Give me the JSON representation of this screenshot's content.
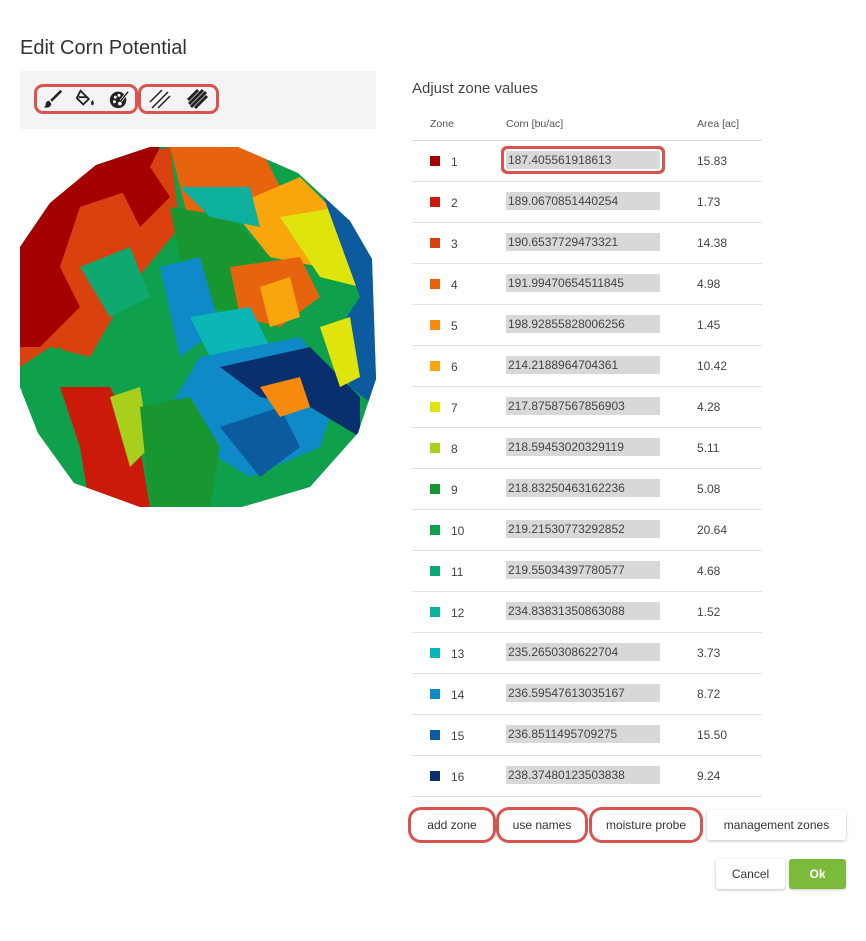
{
  "dialog": {
    "title": "Edit Corn Potential"
  },
  "toolbar": {
    "tools": [
      {
        "name": "brush-icon"
      },
      {
        "name": "paint-bucket-icon"
      },
      {
        "name": "palette-icon"
      },
      {
        "name": "hatch-light-icon"
      },
      {
        "name": "hatch-dense-icon"
      }
    ]
  },
  "panel": {
    "title": "Adjust zone values",
    "headers": {
      "zone": "Zone",
      "corn": "Corn [bu/ac]",
      "area": "Area [ac]"
    }
  },
  "zones": [
    {
      "zone": "1",
      "corn": "187.405561918613",
      "area": "15.83",
      "color": "#a50000"
    },
    {
      "zone": "2",
      "corn": "189.0670851440254",
      "area": "1.73",
      "color": "#cc1a0a"
    },
    {
      "zone": "3",
      "corn": "190.6537729473321",
      "area": "14.38",
      "color": "#d9410e"
    },
    {
      "zone": "4",
      "corn": "191.99470654511845",
      "area": "4.98",
      "color": "#e7630e"
    },
    {
      "zone": "5",
      "corn": "198.92855828006256",
      "area": "1.45",
      "color": "#f58a0c"
    },
    {
      "zone": "6",
      "corn": "214.2188964704361",
      "area": "10.42",
      "color": "#f9a50c"
    },
    {
      "zone": "7",
      "corn": "217.87587567856903",
      "area": "4.28",
      "color": "#dfe50c"
    },
    {
      "zone": "8",
      "corn": "218.59453020329119",
      "area": "5.11",
      "color": "#a8cf1b"
    },
    {
      "zone": "9",
      "corn": "218.83250463162236",
      "area": "5.08",
      "color": "#18962f"
    },
    {
      "zone": "10",
      "corn": "219.21530773292852",
      "area": "20.64",
      "color": "#0ea04b"
    },
    {
      "zone": "11",
      "corn": "219.55034397780577",
      "area": "4.68",
      "color": "#0fa870"
    },
    {
      "zone": "12",
      "corn": "234.83831350863088",
      "area": "1.52",
      "color": "#0db09c"
    },
    {
      "zone": "13",
      "corn": "235.2650308622704",
      "area": "3.73",
      "color": "#0bb6b6"
    },
    {
      "zone": "14",
      "corn": "236.59547613035167",
      "area": "8.72",
      "color": "#0e8ac8"
    },
    {
      "zone": "15",
      "corn": "236.8511495709275",
      "area": "15.50",
      "color": "#0b5b9e"
    },
    {
      "zone": "16",
      "corn": "238.37480123503838",
      "area": "9.24",
      "color": "#0a2f6e"
    }
  ],
  "buttons": {
    "add_zone": "add zone",
    "use_names": "use names",
    "moisture_probe": "moisture probe",
    "management_zones": "management zones",
    "cancel": "Cancel",
    "ok": "Ok"
  },
  "colors": {
    "highlight": "#d9534f",
    "ok_button": "#7cba3c"
  }
}
